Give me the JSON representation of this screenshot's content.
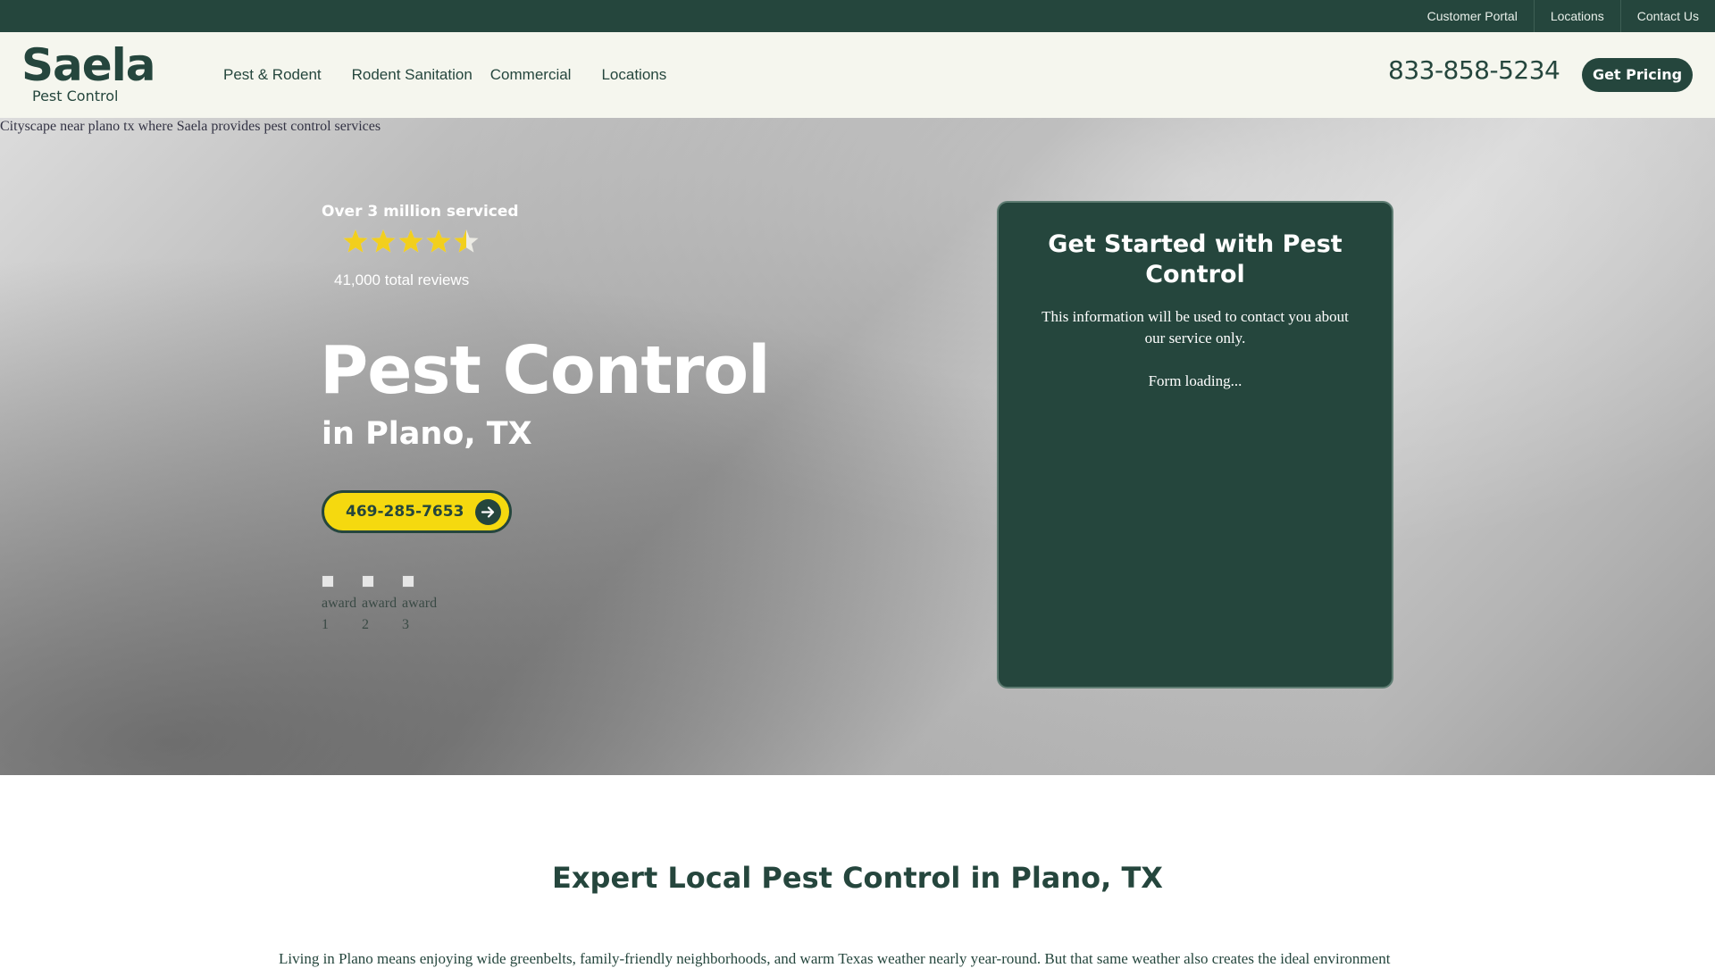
{
  "topbar": {
    "links": [
      "Customer Portal",
      "Locations",
      "Contact Us"
    ]
  },
  "header": {
    "logo_word": "Saela",
    "logo_sub": "Pest Control",
    "nav": [
      "Pest & Rodent",
      "Rodent Sanitation",
      "Commercial",
      "Locations"
    ],
    "phone": "833-858-5234",
    "cta": "Get Pricing"
  },
  "hero": {
    "image_alt": "Cityscape near plano tx where Saela provides pest control services",
    "serviced": "Over 3 million serviced",
    "rating": 4.5,
    "rating_max": 5,
    "reviews": "41,000 total reviews",
    "title": "Pest Control",
    "subtitle": "in Plano, TX",
    "call_number": "469-285-7653",
    "awards": [
      "award 1",
      "award 2",
      "award 3"
    ]
  },
  "form": {
    "title": "Get Started with Pest Control",
    "note": "This information will be used to contact you about our service only.",
    "loading": "Form loading..."
  },
  "section": {
    "title": "Expert Local Pest Control in Plano, TX",
    "body": "Living in Plano means enjoying wide greenbelts, family-friendly neighborhoods, and warm Texas weather nearly year-round. But that same weather also creates the ideal environment"
  },
  "colors": {
    "brand_dark": "#25463d",
    "accent_yellow": "#f5d90f",
    "header_bg": "#f5f6ee",
    "star": "#f2cf1d"
  },
  "icons": {
    "stars": "star-icon",
    "call_arrow": "arrow-right-circle-icon"
  }
}
